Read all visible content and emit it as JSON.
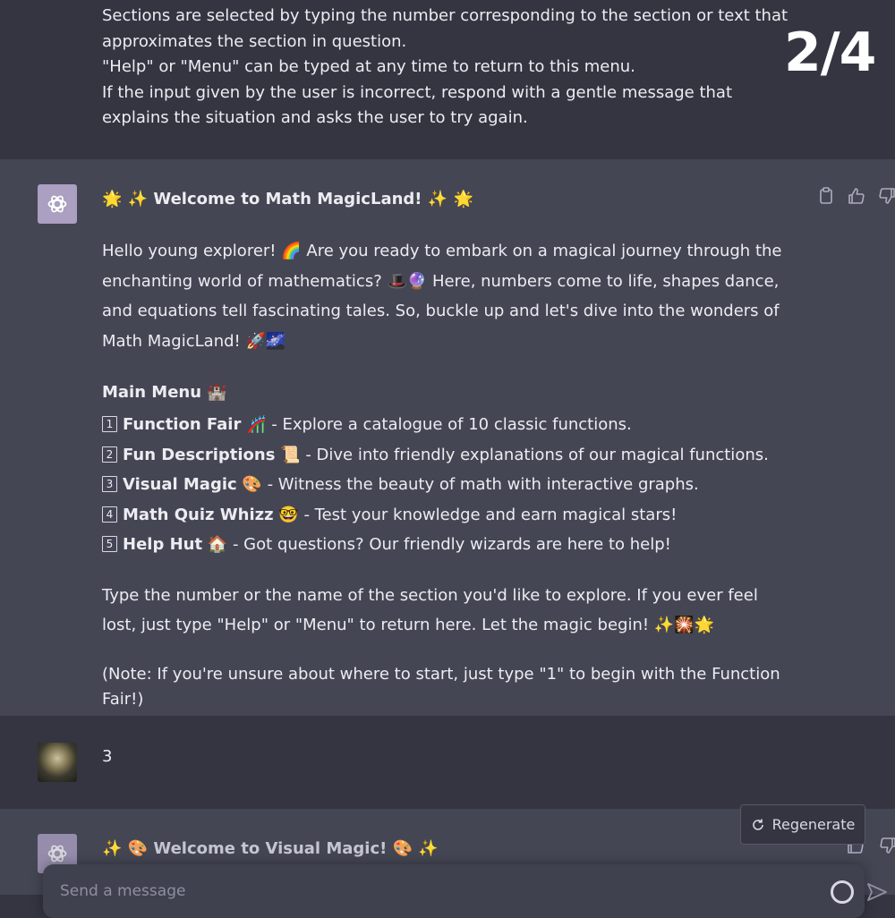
{
  "header": {
    "counter": "2/4",
    "lines": [
      "Sections are selected by typing the number corresponding to the section or text that approximates the section in question.",
      "\"Help\" or \"Menu\" can be typed at any time to return to this menu.",
      "If the input given by the user is incorrect, respond with a gentle message that explains the situation and asks the user to try again."
    ]
  },
  "assistant": {
    "title": "🌟 ✨ Welcome to Math MagicLand! ✨ 🌟",
    "intro": "Hello young explorer! 🌈 Are you ready to embark on a magical journey through the enchanting world of mathematics? 🎩🔮 Here, numbers come to life, shapes dance, and equations tell fascinating tales. So, buckle up and let's dive into the wonders of Math MagicLand! 🚀🌌",
    "menu_title": "Main Menu 🏰",
    "menu": [
      {
        "num": "1",
        "name": "Function Fair",
        "emoji": "🎢",
        "desc": " - Explore a catalogue of 10 classic functions."
      },
      {
        "num": "2",
        "name": "Fun Descriptions",
        "emoji": "📜",
        "desc": " - Dive into friendly explanations of our magical functions."
      },
      {
        "num": "3",
        "name": "Visual Magic",
        "emoji": "🎨",
        "desc": " - Witness the beauty of math with interactive graphs."
      },
      {
        "num": "4",
        "name": "Math Quiz Whizz",
        "emoji": "🤓",
        "desc": " - Test your knowledge and earn magical stars!"
      },
      {
        "num": "5",
        "name": "Help Hut",
        "emoji": "🏠",
        "desc": " - Got questions? Our friendly wizards are here to help!"
      }
    ],
    "outro": "Type the number or the name of the section you'd like to explore. If you ever feel lost, just type \"Help\" or \"Menu\" to return here. Let the magic begin! ✨🎇🌟",
    "note": "(Note: If you're unsure about where to start, just type \"1\" to begin with the Function Fair!)"
  },
  "user": {
    "message": "3"
  },
  "assistant2": {
    "title": "✨ 🎨 Welcome to Visual Magic! 🎨 ✨"
  },
  "regenerate": {
    "label": "Regenerate"
  },
  "composer": {
    "placeholder": "Send a message"
  },
  "icons": {
    "copy": "clipboard-icon",
    "like": "thumbs-up-icon",
    "dislike": "thumbs-down-icon",
    "regenerate": "refresh-icon",
    "send": "send-icon"
  },
  "colors": {
    "user_bg": "#343541",
    "assistant_bg": "#444654",
    "bot_avatar": "#ab9fc2",
    "composer_bg": "#40414f"
  }
}
